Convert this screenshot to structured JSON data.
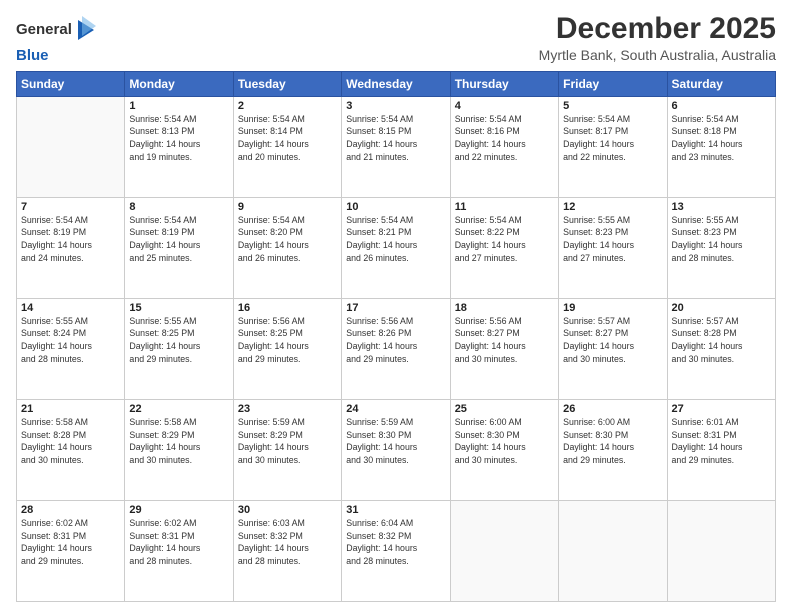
{
  "logo": {
    "line1": "General",
    "line2": "Blue"
  },
  "title": "December 2025",
  "location": "Myrtle Bank, South Australia, Australia",
  "weekdays": [
    "Sunday",
    "Monday",
    "Tuesday",
    "Wednesday",
    "Thursday",
    "Friday",
    "Saturday"
  ],
  "weeks": [
    [
      {
        "day": "",
        "info": ""
      },
      {
        "day": "1",
        "info": "Sunrise: 5:54 AM\nSunset: 8:13 PM\nDaylight: 14 hours\nand 19 minutes."
      },
      {
        "day": "2",
        "info": "Sunrise: 5:54 AM\nSunset: 8:14 PM\nDaylight: 14 hours\nand 20 minutes."
      },
      {
        "day": "3",
        "info": "Sunrise: 5:54 AM\nSunset: 8:15 PM\nDaylight: 14 hours\nand 21 minutes."
      },
      {
        "day": "4",
        "info": "Sunrise: 5:54 AM\nSunset: 8:16 PM\nDaylight: 14 hours\nand 22 minutes."
      },
      {
        "day": "5",
        "info": "Sunrise: 5:54 AM\nSunset: 8:17 PM\nDaylight: 14 hours\nand 22 minutes."
      },
      {
        "day": "6",
        "info": "Sunrise: 5:54 AM\nSunset: 8:18 PM\nDaylight: 14 hours\nand 23 minutes."
      }
    ],
    [
      {
        "day": "7",
        "info": "Sunrise: 5:54 AM\nSunset: 8:19 PM\nDaylight: 14 hours\nand 24 minutes."
      },
      {
        "day": "8",
        "info": "Sunrise: 5:54 AM\nSunset: 8:19 PM\nDaylight: 14 hours\nand 25 minutes."
      },
      {
        "day": "9",
        "info": "Sunrise: 5:54 AM\nSunset: 8:20 PM\nDaylight: 14 hours\nand 26 minutes."
      },
      {
        "day": "10",
        "info": "Sunrise: 5:54 AM\nSunset: 8:21 PM\nDaylight: 14 hours\nand 26 minutes."
      },
      {
        "day": "11",
        "info": "Sunrise: 5:54 AM\nSunset: 8:22 PM\nDaylight: 14 hours\nand 27 minutes."
      },
      {
        "day": "12",
        "info": "Sunrise: 5:55 AM\nSunset: 8:23 PM\nDaylight: 14 hours\nand 27 minutes."
      },
      {
        "day": "13",
        "info": "Sunrise: 5:55 AM\nSunset: 8:23 PM\nDaylight: 14 hours\nand 28 minutes."
      }
    ],
    [
      {
        "day": "14",
        "info": "Sunrise: 5:55 AM\nSunset: 8:24 PM\nDaylight: 14 hours\nand 28 minutes."
      },
      {
        "day": "15",
        "info": "Sunrise: 5:55 AM\nSunset: 8:25 PM\nDaylight: 14 hours\nand 29 minutes."
      },
      {
        "day": "16",
        "info": "Sunrise: 5:56 AM\nSunset: 8:25 PM\nDaylight: 14 hours\nand 29 minutes."
      },
      {
        "day": "17",
        "info": "Sunrise: 5:56 AM\nSunset: 8:26 PM\nDaylight: 14 hours\nand 29 minutes."
      },
      {
        "day": "18",
        "info": "Sunrise: 5:56 AM\nSunset: 8:27 PM\nDaylight: 14 hours\nand 30 minutes."
      },
      {
        "day": "19",
        "info": "Sunrise: 5:57 AM\nSunset: 8:27 PM\nDaylight: 14 hours\nand 30 minutes."
      },
      {
        "day": "20",
        "info": "Sunrise: 5:57 AM\nSunset: 8:28 PM\nDaylight: 14 hours\nand 30 minutes."
      }
    ],
    [
      {
        "day": "21",
        "info": "Sunrise: 5:58 AM\nSunset: 8:28 PM\nDaylight: 14 hours\nand 30 minutes."
      },
      {
        "day": "22",
        "info": "Sunrise: 5:58 AM\nSunset: 8:29 PM\nDaylight: 14 hours\nand 30 minutes."
      },
      {
        "day": "23",
        "info": "Sunrise: 5:59 AM\nSunset: 8:29 PM\nDaylight: 14 hours\nand 30 minutes."
      },
      {
        "day": "24",
        "info": "Sunrise: 5:59 AM\nSunset: 8:30 PM\nDaylight: 14 hours\nand 30 minutes."
      },
      {
        "day": "25",
        "info": "Sunrise: 6:00 AM\nSunset: 8:30 PM\nDaylight: 14 hours\nand 30 minutes."
      },
      {
        "day": "26",
        "info": "Sunrise: 6:00 AM\nSunset: 8:30 PM\nDaylight: 14 hours\nand 29 minutes."
      },
      {
        "day": "27",
        "info": "Sunrise: 6:01 AM\nSunset: 8:31 PM\nDaylight: 14 hours\nand 29 minutes."
      }
    ],
    [
      {
        "day": "28",
        "info": "Sunrise: 6:02 AM\nSunset: 8:31 PM\nDaylight: 14 hours\nand 29 minutes."
      },
      {
        "day": "29",
        "info": "Sunrise: 6:02 AM\nSunset: 8:31 PM\nDaylight: 14 hours\nand 28 minutes."
      },
      {
        "day": "30",
        "info": "Sunrise: 6:03 AM\nSunset: 8:32 PM\nDaylight: 14 hours\nand 28 minutes."
      },
      {
        "day": "31",
        "info": "Sunrise: 6:04 AM\nSunset: 8:32 PM\nDaylight: 14 hours\nand 28 minutes."
      },
      {
        "day": "",
        "info": ""
      },
      {
        "day": "",
        "info": ""
      },
      {
        "day": "",
        "info": ""
      }
    ]
  ]
}
